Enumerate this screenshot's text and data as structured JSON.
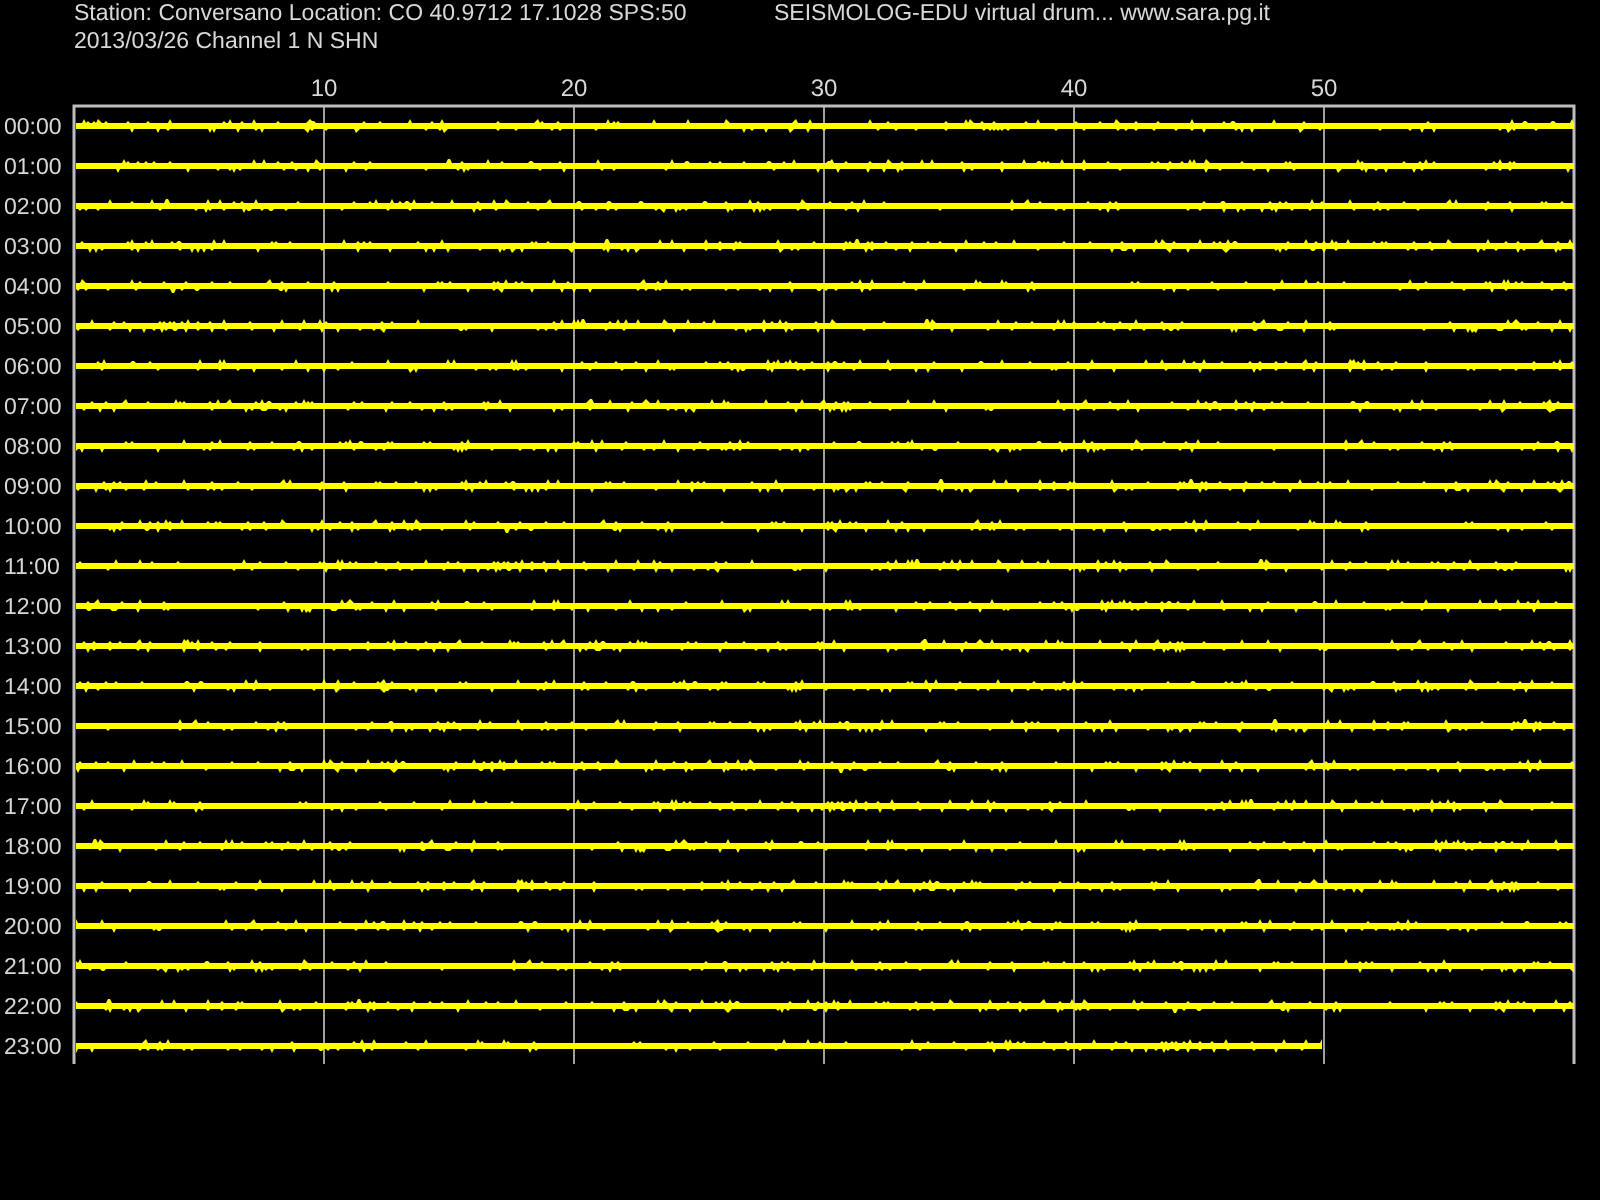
{
  "header": {
    "station": "Station: Conversano Location: CO 40.9712 17.1028 SPS:50",
    "channel": "2013/03/26  Channel 1 N SHN",
    "title": "SEISMOLOG-EDU virtual drum... www.sara.pg.it"
  },
  "minute_ticks": [
    "10",
    "20",
    "30",
    "40",
    "50"
  ],
  "rows": [
    {
      "time": "00:00",
      "level": 1
    },
    {
      "time": "01:00",
      "level": 1
    },
    {
      "time": "02:00",
      "level": 1
    },
    {
      "time": "03:00",
      "level": 1
    },
    {
      "time": "04:00",
      "level": 1
    },
    {
      "time": "05:00",
      "level": 1
    },
    {
      "time": "06:00",
      "level": 1
    },
    {
      "time": "07:00",
      "level": 1
    },
    {
      "time": "08:00",
      "level": 1
    },
    {
      "time": "09:00",
      "level": 1
    },
    {
      "time": "10:00",
      "level": 1
    },
    {
      "time": "11:00",
      "level": 1
    },
    {
      "time": "12:00",
      "level": 1
    },
    {
      "time": "13:00",
      "level": 1
    },
    {
      "time": "14:00",
      "level": 1
    },
    {
      "time": "15:00",
      "level": 1
    },
    {
      "time": "16:00",
      "level": 1
    },
    {
      "time": "17:00",
      "level": 1
    },
    {
      "time": "18:00",
      "level": 1
    },
    {
      "time": "19:00",
      "level": 1
    },
    {
      "time": "20:00",
      "level": 1
    },
    {
      "time": "21:00",
      "level": 1
    },
    {
      "time": "22:00",
      "level": 1
    },
    {
      "time": "23:00",
      "level": 0.8333
    }
  ]
}
